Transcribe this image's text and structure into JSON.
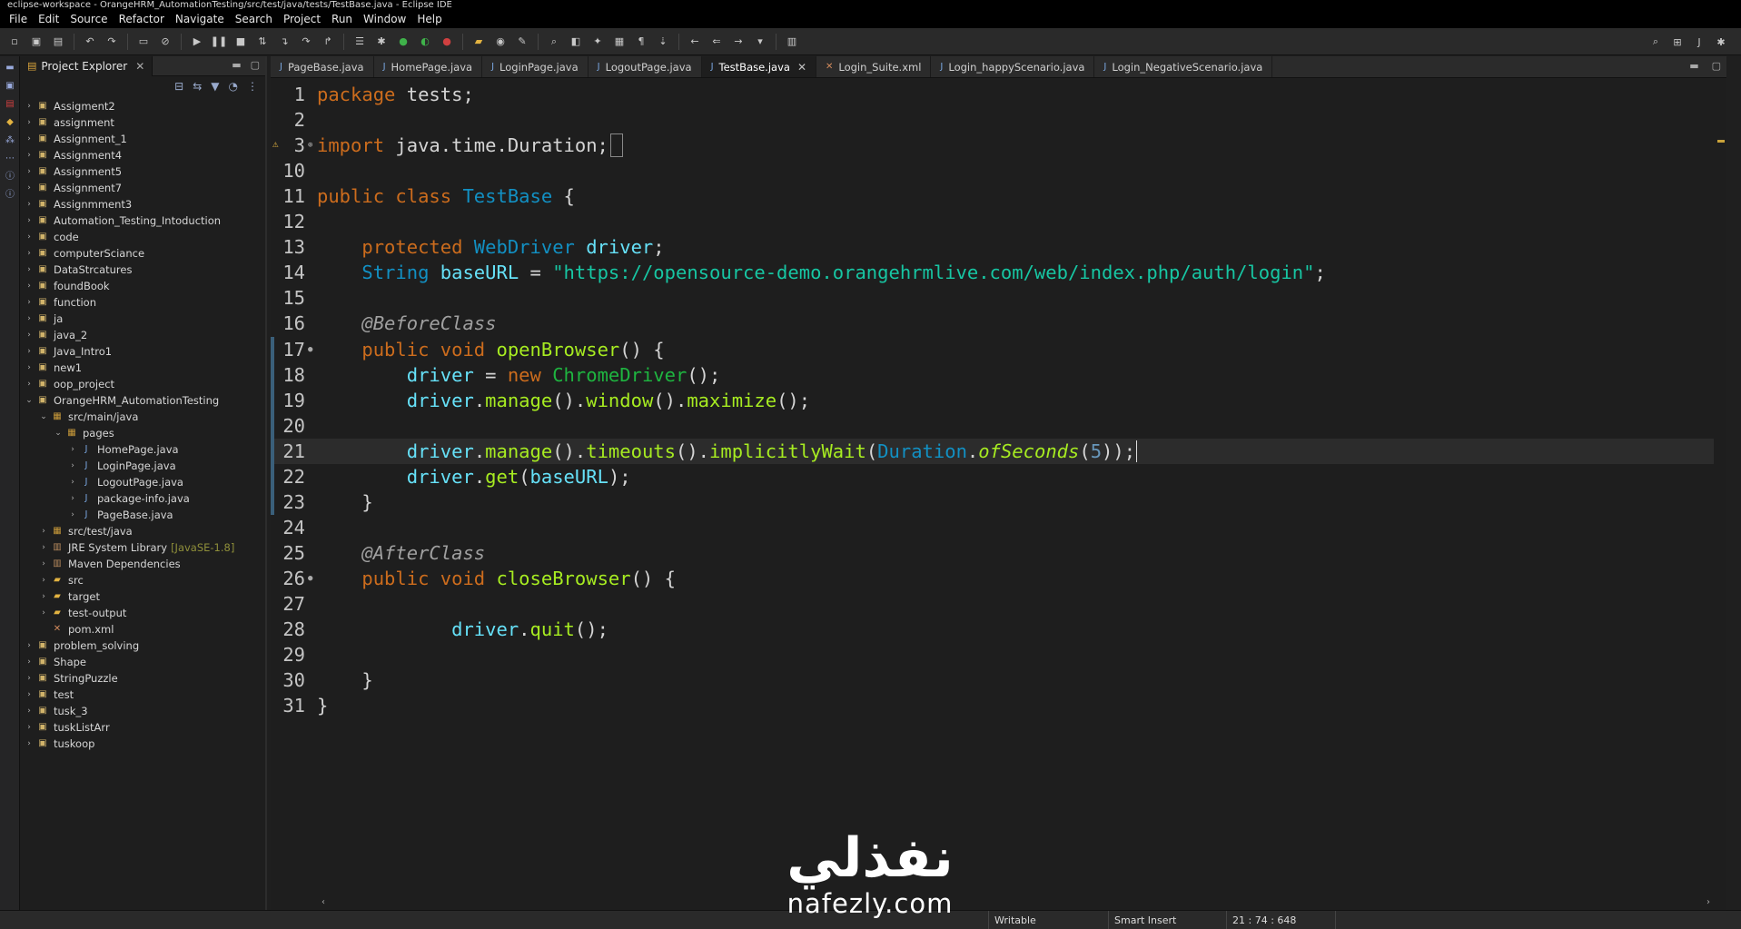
{
  "window": {
    "title": "eclipse-workspace - OrangeHRM_AutomationTesting/src/test/java/tests/TestBase.java - Eclipse IDE"
  },
  "menu": [
    "File",
    "Edit",
    "Source",
    "Refactor",
    "Navigate",
    "Search",
    "Project",
    "Run",
    "Window",
    "Help"
  ],
  "explorer": {
    "title": "Project Explorer",
    "items": [
      {
        "label": "Assigment2",
        "type": "project",
        "depth": 0,
        "expanded": false
      },
      {
        "label": "assignment",
        "type": "project",
        "depth": 0,
        "expanded": false
      },
      {
        "label": "Assignment_1",
        "type": "project",
        "depth": 0,
        "expanded": false
      },
      {
        "label": "Assignment4",
        "type": "project",
        "depth": 0,
        "expanded": false
      },
      {
        "label": "Assignment5",
        "type": "project",
        "depth": 0,
        "expanded": false
      },
      {
        "label": "Assignment7",
        "type": "project",
        "depth": 0,
        "expanded": false
      },
      {
        "label": "Assignmment3",
        "type": "project",
        "depth": 0,
        "expanded": false
      },
      {
        "label": "Automation_Testing_Intoduction",
        "type": "project",
        "depth": 0,
        "expanded": false
      },
      {
        "label": "code",
        "type": "project",
        "depth": 0,
        "expanded": false
      },
      {
        "label": "computerSciance",
        "type": "project",
        "depth": 0,
        "expanded": false
      },
      {
        "label": "DataStrcatures",
        "type": "project",
        "depth": 0,
        "expanded": false
      },
      {
        "label": "foundBook",
        "type": "project",
        "depth": 0,
        "expanded": false
      },
      {
        "label": "function",
        "type": "project",
        "depth": 0,
        "expanded": false
      },
      {
        "label": "ja",
        "type": "project",
        "depth": 0,
        "expanded": false
      },
      {
        "label": "java_2",
        "type": "project",
        "depth": 0,
        "expanded": false
      },
      {
        "label": "Java_Intro1",
        "type": "project",
        "depth": 0,
        "expanded": false
      },
      {
        "label": "new1",
        "type": "project",
        "depth": 0,
        "expanded": false
      },
      {
        "label": "oop_project",
        "type": "project",
        "depth": 0,
        "expanded": false
      },
      {
        "label": "OrangeHRM_AutomationTesting",
        "type": "project",
        "depth": 0,
        "expanded": true
      },
      {
        "label": "src/main/java",
        "type": "package",
        "depth": 1,
        "expanded": true
      },
      {
        "label": "pages",
        "type": "package",
        "depth": 2,
        "expanded": true
      },
      {
        "label": "HomePage.java",
        "type": "java",
        "depth": 3,
        "expanded": false
      },
      {
        "label": "LoginPage.java",
        "type": "java",
        "depth": 3,
        "expanded": false
      },
      {
        "label": "LogoutPage.java",
        "type": "java",
        "depth": 3,
        "expanded": false
      },
      {
        "label": "package-info.java",
        "type": "java",
        "depth": 3,
        "expanded": false
      },
      {
        "label": "PageBase.java",
        "type": "java",
        "depth": 3,
        "expanded": false
      },
      {
        "label": "src/test/java",
        "type": "package",
        "depth": 1,
        "expanded": false
      },
      {
        "label": "JRE System Library",
        "type": "lib",
        "depth": 1,
        "expanded": false,
        "extra": "[JavaSE-1.8]"
      },
      {
        "label": "Maven Dependencies",
        "type": "lib",
        "depth": 1,
        "expanded": false
      },
      {
        "label": "src",
        "type": "folder",
        "depth": 1,
        "expanded": false
      },
      {
        "label": "target",
        "type": "folder",
        "depth": 1,
        "expanded": false
      },
      {
        "label": "test-output",
        "type": "folder",
        "depth": 1,
        "expanded": false
      },
      {
        "label": "pom.xml",
        "type": "xml",
        "depth": 1,
        "leaf": true
      },
      {
        "label": "problem_solving",
        "type": "project",
        "depth": 0,
        "expanded": false
      },
      {
        "label": "Shape",
        "type": "project",
        "depth": 0,
        "expanded": false
      },
      {
        "label": "StringPuzzle",
        "type": "project",
        "depth": 0,
        "expanded": false
      },
      {
        "label": "test",
        "type": "project",
        "depth": 0,
        "expanded": false
      },
      {
        "label": "tusk_3",
        "type": "project",
        "depth": 0,
        "expanded": false
      },
      {
        "label": "tuskListArr",
        "type": "project",
        "depth": 0,
        "expanded": false
      },
      {
        "label": "tuskoop",
        "type": "project",
        "depth": 0,
        "expanded": false
      }
    ]
  },
  "editor": {
    "tabs": [
      {
        "label": "PageBase.java",
        "active": false
      },
      {
        "label": "HomePage.java",
        "active": false
      },
      {
        "label": "LoginPage.java",
        "active": false
      },
      {
        "label": "LogoutPage.java",
        "active": false
      },
      {
        "label": "TestBase.java",
        "active": true
      },
      {
        "label": "Login_Suite.xml",
        "active": false
      },
      {
        "label": "Login_happyScenario.java",
        "active": false
      },
      {
        "label": "Login_NegativeScenario.java",
        "active": false
      }
    ],
    "current_line": "21",
    "lines": [
      {
        "n": "1",
        "tokens": [
          [
            "kw",
            "package"
          ],
          [
            "plain",
            " tests;"
          ]
        ]
      },
      {
        "n": "2",
        "tokens": []
      },
      {
        "n": "3",
        "mark": "⊕",
        "tokens": [
          [
            "kw",
            "import"
          ],
          [
            "plain",
            " java.time.Duration;"
          ]
        ],
        "folded": true
      },
      {
        "n": "10",
        "tokens": []
      },
      {
        "n": "11",
        "tokens": [
          [
            "kw",
            "public class "
          ],
          [
            "type",
            "TestBase"
          ],
          [
            "plain",
            " {"
          ]
        ]
      },
      {
        "n": "12",
        "tokens": []
      },
      {
        "n": "13",
        "tokens": [
          [
            "plain",
            "    "
          ],
          [
            "kw",
            "protected "
          ],
          [
            "type",
            "WebDriver "
          ],
          [
            "fld",
            "driver"
          ],
          [
            "plain",
            ";"
          ]
        ]
      },
      {
        "n": "14",
        "tokens": [
          [
            "plain",
            "    "
          ],
          [
            "type",
            "String "
          ],
          [
            "fld",
            "baseURL"
          ],
          [
            "plain",
            " = "
          ],
          [
            "str",
            "\"https://opensource-demo.orangehrmlive.com/web/index.php/auth/login\""
          ],
          [
            "plain",
            ";"
          ]
        ]
      },
      {
        "n": "15",
        "tokens": []
      },
      {
        "n": "16",
        "tokens": [
          [
            "plain",
            "    "
          ],
          [
            "ann",
            "@BeforeClass"
          ]
        ]
      },
      {
        "n": "17",
        "mark": "●",
        "tokens": [
          [
            "plain",
            "    "
          ],
          [
            "kw",
            "public void "
          ],
          [
            "mth",
            "openBrowser"
          ],
          [
            "plain",
            "() {"
          ]
        ]
      },
      {
        "n": "18",
        "tokens": [
          [
            "plain",
            "        "
          ],
          [
            "fld",
            "driver"
          ],
          [
            "plain",
            " = "
          ],
          [
            "kw",
            "new "
          ],
          [
            "typeg",
            "ChromeDriver"
          ],
          [
            "plain",
            "();"
          ]
        ]
      },
      {
        "n": "19",
        "tokens": [
          [
            "plain",
            "        "
          ],
          [
            "fld",
            "driver"
          ],
          [
            "plain",
            "."
          ],
          [
            "mth",
            "manage"
          ],
          [
            "plain",
            "()."
          ],
          [
            "mth",
            "window"
          ],
          [
            "plain",
            "()."
          ],
          [
            "mth",
            "maximize"
          ],
          [
            "plain",
            "();"
          ]
        ]
      },
      {
        "n": "20",
        "tokens": []
      },
      {
        "n": "21",
        "tokens": [
          [
            "plain",
            "        "
          ],
          [
            "fld",
            "driver"
          ],
          [
            "plain",
            "."
          ],
          [
            "mth",
            "manage"
          ],
          [
            "plain",
            "()."
          ],
          [
            "mth",
            "timeouts"
          ],
          [
            "plain",
            "()."
          ],
          [
            "mth",
            "implicitlyWait"
          ],
          [
            "plain",
            "("
          ],
          [
            "type",
            "Duration"
          ],
          [
            "plain",
            "."
          ],
          [
            "mthi",
            "ofSeconds"
          ],
          [
            "plain",
            "("
          ],
          [
            "num",
            "5"
          ],
          [
            "plain",
            "));"
          ]
        ]
      },
      {
        "n": "22",
        "tokens": [
          [
            "plain",
            "        "
          ],
          [
            "fld",
            "driver"
          ],
          [
            "plain",
            "."
          ],
          [
            "mth",
            "get"
          ],
          [
            "plain",
            "("
          ],
          [
            "fld",
            "baseURL"
          ],
          [
            "plain",
            ");"
          ]
        ]
      },
      {
        "n": "23",
        "tokens": [
          [
            "plain",
            "    }"
          ]
        ]
      },
      {
        "n": "24",
        "tokens": []
      },
      {
        "n": "25",
        "tokens": [
          [
            "plain",
            "    "
          ],
          [
            "ann",
            "@AfterClass"
          ]
        ]
      },
      {
        "n": "26",
        "mark": "●",
        "tokens": [
          [
            "plain",
            "    "
          ],
          [
            "kw",
            "public void "
          ],
          [
            "mth",
            "closeBrowser"
          ],
          [
            "plain",
            "() {"
          ]
        ]
      },
      {
        "n": "27",
        "tokens": []
      },
      {
        "n": "28",
        "tokens": [
          [
            "plain",
            "            "
          ],
          [
            "fld",
            "driver"
          ],
          [
            "plain",
            "."
          ],
          [
            "mth",
            "quit"
          ],
          [
            "plain",
            "();"
          ]
        ]
      },
      {
        "n": "29",
        "tokens": []
      },
      {
        "n": "30",
        "tokens": [
          [
            "plain",
            "    }"
          ]
        ]
      },
      {
        "n": "31",
        "tokens": [
          [
            "plain",
            "}"
          ]
        ]
      }
    ]
  },
  "status": {
    "writable": "Writable",
    "insert_mode": "Smart Insert",
    "position": "21 : 74 : 648"
  },
  "watermark": {
    "arabic": "نفذلي",
    "latin": "nafezly.com"
  },
  "colors": {
    "keyword": "#cc6c1d",
    "type": "#1290c3",
    "field": "#66e1f8",
    "method": "#a7ec21",
    "string": "#17c6a3"
  }
}
